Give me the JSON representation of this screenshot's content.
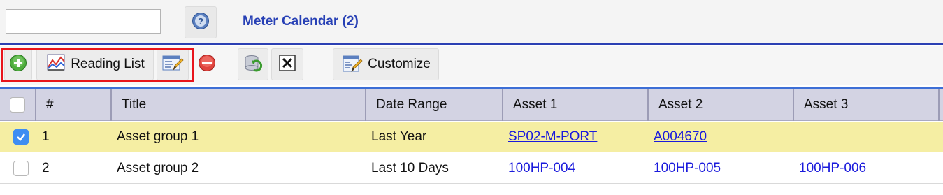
{
  "header": {
    "search": {
      "value": "",
      "placeholder": ""
    },
    "help_icon": "help-question-icon",
    "title": "Meter Calendar (2)"
  },
  "toolbar": {
    "add_icon": "add-circle-icon",
    "reading_list_label": "Reading List",
    "reading_list_icon": "chart-icon",
    "edit_icon": "edit-form-icon",
    "delete_icon": "remove-circle-icon",
    "refresh_icon": "refresh-icon",
    "close_icon": "close-box-icon",
    "customize_label": "Customize",
    "customize_icon": "customize-icon",
    "highlight_color": "#e8141c"
  },
  "grid": {
    "columns": [
      "",
      "#",
      "Title",
      "Date Range",
      "Asset 1",
      "Asset 2",
      "Asset 3"
    ],
    "rows": [
      {
        "checked": true,
        "num": "1",
        "title": "Asset group 1",
        "date_range": "Last Year",
        "asset1": "SP02-M-PORT",
        "asset2": "A004670",
        "asset3": ""
      },
      {
        "checked": false,
        "num": "2",
        "title": "Asset group 2",
        "date_range": "Last 10 Days",
        "asset1": "100HP-004",
        "asset2": "100HP-005",
        "asset3": "100HP-006"
      }
    ]
  },
  "colors": {
    "accent": "#2740b5",
    "link": "#1a1adc",
    "selected_row": "#f5eea3",
    "header_bg": "#d3d3e3",
    "checkbox_checked": "#3e8df2"
  }
}
